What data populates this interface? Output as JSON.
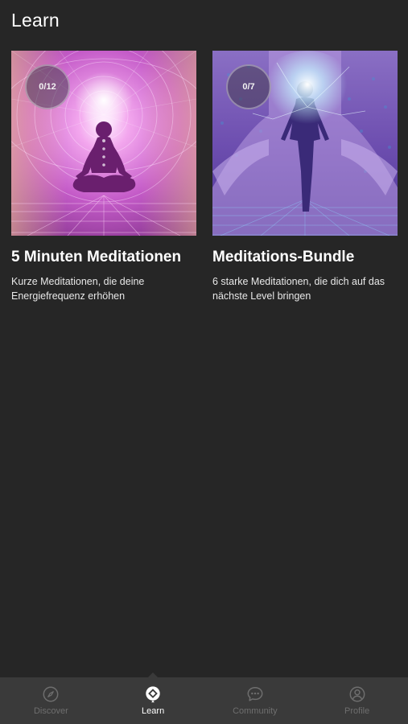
{
  "header": {
    "title": "Learn"
  },
  "courses": [
    {
      "progress": "0/12",
      "title": "5 Minuten Meditationen",
      "description": "Kurze Meditationen, die deine Energiefrequenz erhöhen"
    },
    {
      "progress": "0/7",
      "title": "Meditations-Bundle",
      "description": "6 starke Meditationen, die dich auf das nächste Level bringen"
    }
  ],
  "tabbar": {
    "active": "learn",
    "tabs": [
      {
        "id": "discover",
        "label": "Discover",
        "icon": "compass-icon"
      },
      {
        "id": "learn",
        "label": "Learn",
        "icon": "learn-icon"
      },
      {
        "id": "community",
        "label": "Community",
        "icon": "chat-bubble-icon"
      },
      {
        "id": "profile",
        "label": "Profile",
        "icon": "user-icon"
      }
    ]
  },
  "colors": {
    "background": "#262626",
    "tabbar": "#3a3a3a",
    "tab_inactive": "#6e6e6e",
    "tab_active": "#ffffff"
  }
}
